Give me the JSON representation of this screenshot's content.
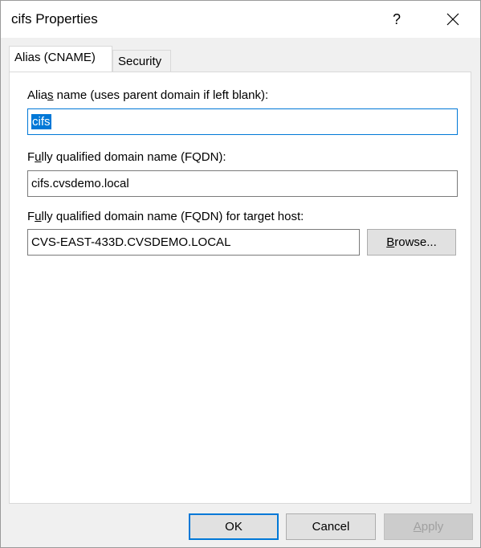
{
  "window": {
    "title": "cifs Properties",
    "help_glyph": "?",
    "close_icon": "close-icon"
  },
  "tabs": [
    {
      "label": "Alias (CNAME)",
      "active": true
    },
    {
      "label": "Security",
      "active": false
    }
  ],
  "form": {
    "alias_label_pre": "Alia",
    "alias_label_acc": "s",
    "alias_label_post": " name (uses parent domain if left blank):",
    "alias_value": "cifs",
    "fqdn_label_pre": "F",
    "fqdn_label_acc": "u",
    "fqdn_label_post": "lly qualified domain name (FQDN):",
    "fqdn_value": "cifs.cvsdemo.local",
    "target_label_pre": "F",
    "target_label_acc": "u",
    "target_label_post": "lly qualified domain name (FQDN) for target host:",
    "target_value": "CVS-EAST-433D.CVSDEMO.LOCAL",
    "browse_pre": "",
    "browse_acc": "B",
    "browse_post": "rowse..."
  },
  "footer": {
    "ok_label": "OK",
    "cancel_label": "Cancel",
    "apply_acc": "A",
    "apply_post": "pply"
  },
  "colors": {
    "accent": "#0078d7",
    "disabled_text": "#a0a0a0"
  }
}
